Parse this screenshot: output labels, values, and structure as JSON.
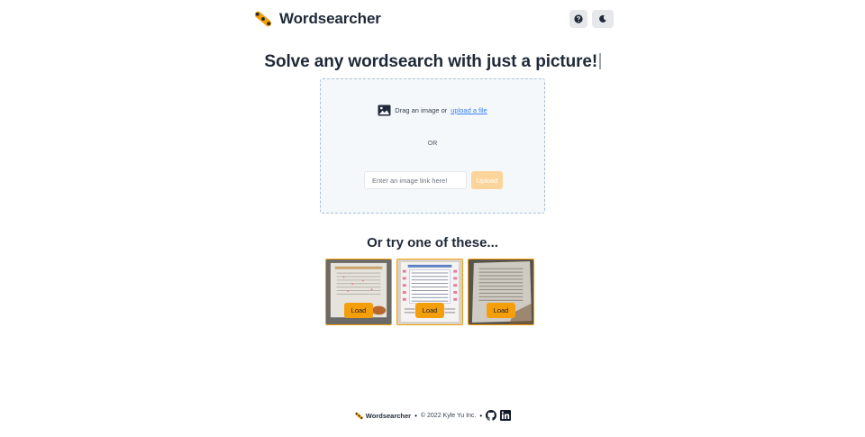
{
  "header": {
    "brand_name": "Wordsearcher",
    "logo_icon": "highlighter-logo-icon",
    "help_icon": "question-circle-icon",
    "theme_icon": "moon-icon"
  },
  "hero": {
    "title": "Solve any wordsearch with just a picture!"
  },
  "upload": {
    "image_icon": "image-icon",
    "drag_text": "Drag an image or ",
    "upload_link": "upload a file",
    "or_text": "OR",
    "link_placeholder": "Enter an image link here!",
    "link_value": "",
    "upload_button": "Upload"
  },
  "samples": {
    "title": "Or try one of these...",
    "items": [
      {
        "load_label": "Load"
      },
      {
        "load_label": "Load"
      },
      {
        "load_label": "Load"
      }
    ]
  },
  "footer": {
    "brand_name": "Wordsearcher",
    "separator": "•",
    "copyright": "© 2022 Kyle Yu Inc.",
    "github_icon": "github-icon",
    "linkedin_icon": "linkedin-icon"
  },
  "colors": {
    "accent": "#f59e0b",
    "accent_disabled": "#fbd49a",
    "link": "#3b82f6",
    "dropzone_bg": "#f5f8fb",
    "dropzone_border": "#a9c0d6",
    "text": "#1f2937"
  }
}
